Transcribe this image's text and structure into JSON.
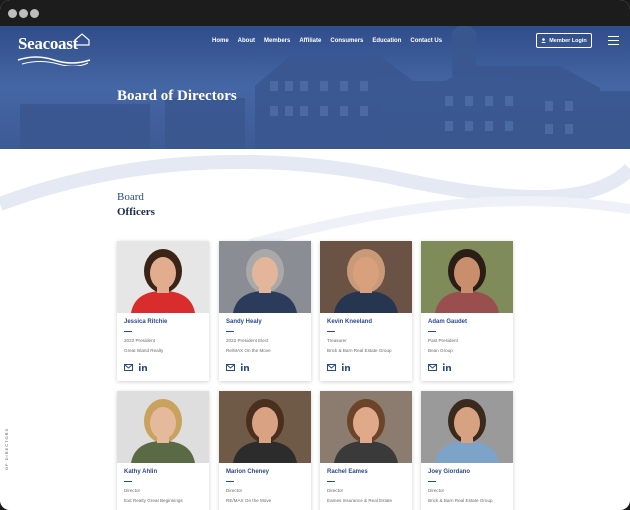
{
  "site": {
    "logo_text": "Seacoast",
    "nav": [
      "Home",
      "About",
      "Members",
      "Affiliate",
      "Consumers",
      "Education",
      "Contact Us"
    ],
    "login_label": "Member Login",
    "hero_title": "Board of Directors"
  },
  "section": {
    "subtitle": "Board",
    "title": "Officers"
  },
  "side_label": "OF DIRECTORS",
  "members": [
    {
      "name": "Jessica Ritchie",
      "role": "2022 President",
      "company": "Great Island Realty",
      "hair": "#3a2418",
      "top": "#d92c2c",
      "skin": "#e2ad8f",
      "bg": "#e6e6e6"
    },
    {
      "name": "Sandy Healy",
      "role": "2022 President Elect",
      "company": "Re/MAX On the Move",
      "hair": "#a9a9a9",
      "top": "#2a3b5c",
      "skin": "#e3b59a",
      "bg": "#8a8e94"
    },
    {
      "name": "Kevin Kneeland",
      "role": "Treasurer",
      "company": "Brick & Barn Real Estate Group",
      "hair": "#c99a78",
      "top": "#263650",
      "skin": "#d9a07e",
      "bg": "#6a5244"
    },
    {
      "name": "Adam Gaudet",
      "role": "Past President",
      "company": "Bean Group",
      "hair": "#2a1e16",
      "top": "#9a4f4f",
      "skin": "#c98e6c",
      "bg": "#7f8c5a"
    },
    {
      "name": "Kathy Ahlin",
      "role": "Director",
      "company": "Exit Realty Great Beginnings",
      "hair": "#c9a25e",
      "top": "#5a6a44",
      "skin": "#e5b99c",
      "bg": "#dedede"
    },
    {
      "name": "Marion Cheney",
      "role": "Director",
      "company": "RE/MAX On the Move",
      "hair": "#4a2f1e",
      "top": "#2c2c2c",
      "skin": "#d9a283",
      "bg": "#6e5a46"
    },
    {
      "name": "Rachel Eames",
      "role": "Director",
      "company": "Eames Insurance & Real Estate",
      "hair": "#6b4429",
      "top": "#3a3a3a",
      "skin": "#e0a98a",
      "bg": "#8c7c70"
    },
    {
      "name": "Joey Giordano",
      "role": "Director",
      "company": "Brick & Barn Real Estate Group",
      "hair": "#3a2a1e",
      "top": "#7ea3c9",
      "skin": "#d7a281",
      "bg": "#9a9a9a"
    }
  ]
}
